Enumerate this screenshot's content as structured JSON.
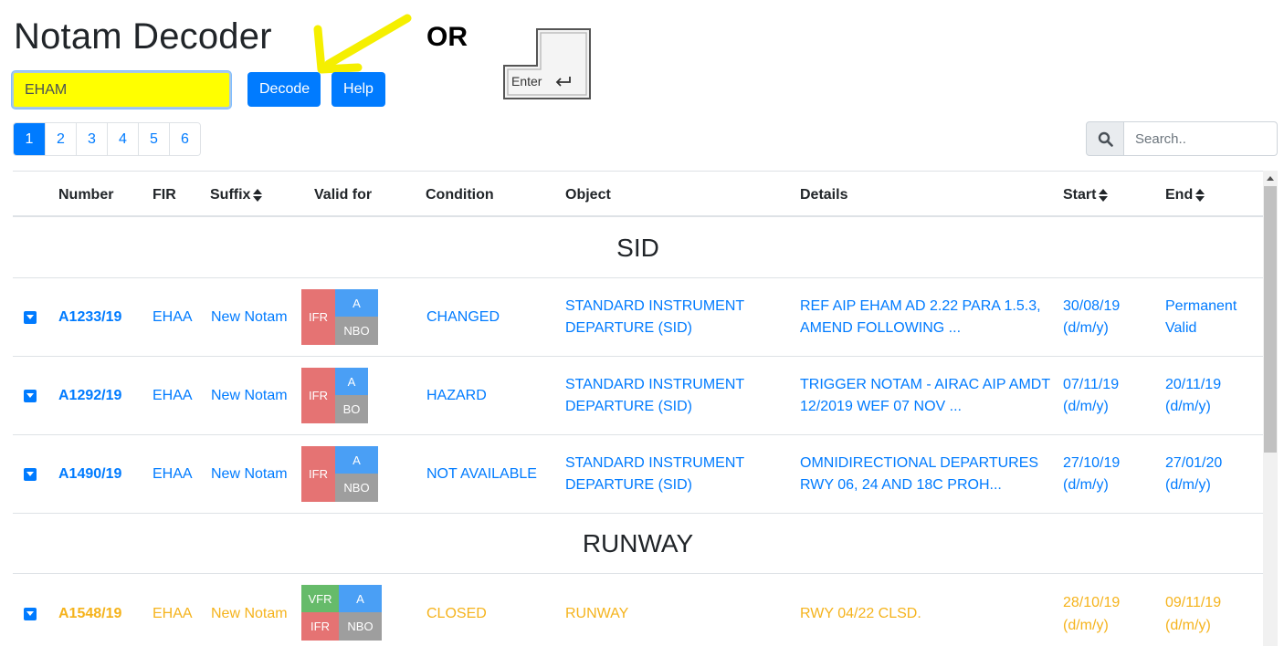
{
  "title": "Notam Decoder",
  "or_text": "OR",
  "enter_key_label": "Enter",
  "search_code": {
    "value": "EHAM"
  },
  "buttons": {
    "decode": "Decode",
    "help": "Help"
  },
  "pagination": [
    "1",
    "2",
    "3",
    "4",
    "5",
    "6"
  ],
  "active_page": "1",
  "search": {
    "placeholder": "Search.."
  },
  "columns": [
    "Number",
    "FIR",
    "Suffix",
    "Valid for",
    "Condition",
    "Object",
    "Details",
    "Start",
    "End"
  ],
  "groups": [
    {
      "name": "SID",
      "rows": [
        {
          "number": "A1233/19",
          "fir": "EHAA",
          "suffix": "New Notam",
          "valid_left": [
            "IFR"
          ],
          "valid_right": [
            "A",
            "NBO"
          ],
          "condition": "CHANGED",
          "object": [
            "STANDARD INSTRUMENT",
            "DEPARTURE (SID)"
          ],
          "details": [
            "REF AIP EHAM AD 2.22 PARA 1.5.3,",
            "AMEND FOLLOWING ..."
          ],
          "start": [
            "30/08/19",
            "(d/m/y)"
          ],
          "end": [
            "Permanent",
            "Valid"
          ],
          "color": "blue"
        },
        {
          "number": "A1292/19",
          "fir": "EHAA",
          "suffix": "New Notam",
          "valid_left": [
            "IFR"
          ],
          "valid_right": [
            "A",
            "BO"
          ],
          "condition": "HAZARD",
          "object": [
            "STANDARD INSTRUMENT",
            "DEPARTURE (SID)"
          ],
          "details": [
            "TRIGGER NOTAM - AIRAC AIP AMDT",
            "12/2019 WEF 07 NOV ..."
          ],
          "start": [
            "07/11/19",
            "(d/m/y)"
          ],
          "end": [
            "20/11/19",
            "(d/m/y)"
          ],
          "color": "blue"
        },
        {
          "number": "A1490/19",
          "fir": "EHAA",
          "suffix": "New Notam",
          "valid_left": [
            "IFR"
          ],
          "valid_right": [
            "A",
            "NBO"
          ],
          "condition": "NOT AVAILABLE",
          "object": [
            "STANDARD INSTRUMENT",
            "DEPARTURE (SID)"
          ],
          "details": [
            "OMNIDIRECTIONAL DEPARTURES",
            "RWY 06, 24 AND 18C PROH..."
          ],
          "start": [
            "27/10/19",
            "(d/m/y)"
          ],
          "end": [
            "27/01/20",
            "(d/m/y)"
          ],
          "color": "blue"
        }
      ]
    },
    {
      "name": "RUNWAY",
      "rows": [
        {
          "number": "A1548/19",
          "fir": "EHAA",
          "suffix": "New Notam",
          "valid_left": [
            "VFR",
            "IFR"
          ],
          "valid_right": [
            "A",
            "NBO"
          ],
          "condition": "CLOSED",
          "object": [
            "RUNWAY"
          ],
          "details": [
            "RWY 04/22 CLSD."
          ],
          "start": [
            "28/10/19",
            "(d/m/y)"
          ],
          "end": [
            "09/11/19",
            "(d/m/y)"
          ],
          "color": "orange"
        }
      ]
    }
  ]
}
